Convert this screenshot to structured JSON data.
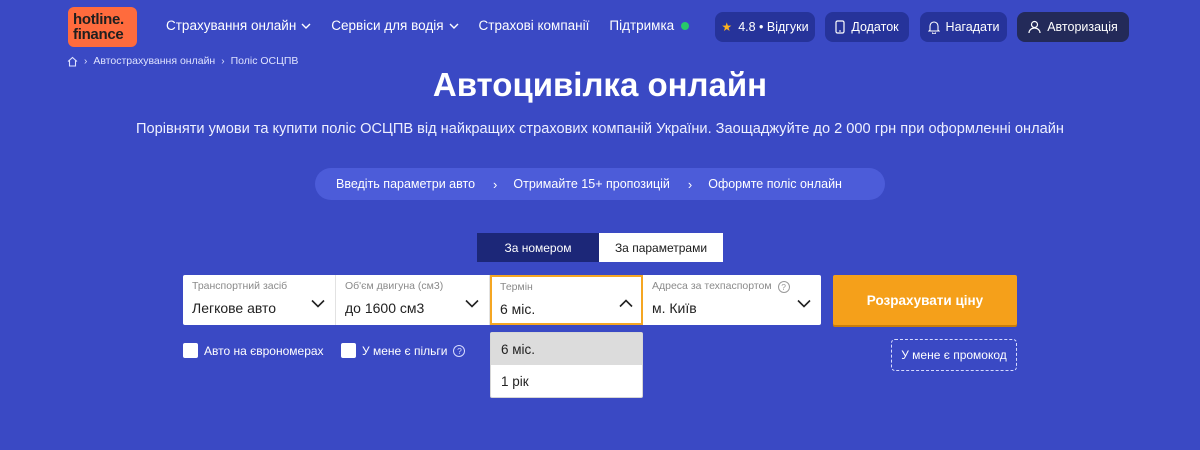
{
  "header": {
    "logo_line1": "hotline.",
    "logo_line2": "finance",
    "nav": [
      {
        "label": "Страхування онлайн",
        "has_dropdown": true
      },
      {
        "label": "Сервіси для водія",
        "has_dropdown": true
      },
      {
        "label": "Страхові компанії",
        "has_dropdown": false
      },
      {
        "label": "Підтримка",
        "status_dot": "online"
      }
    ],
    "reviews_label": "4.8 • Відгуки",
    "app_label": "Додаток",
    "notify_label": "Нагадати",
    "auth_label": "Авторизація"
  },
  "breadcrumbs": [
    "Автострахування онлайн",
    "Поліс ОСЦПВ"
  ],
  "hero": {
    "title": "Автоцивілка онлайн",
    "subtitle": "Порівняти умови та купити поліс ОСЦПВ від найкращих страхових компаній України. Заощаджуйте до 2 000 грн при оформленні онлайн",
    "steps": [
      "Введіть параметри авто",
      "Отримайте 15+ пропозицій",
      "Оформте поліс онлайн"
    ]
  },
  "tabs": [
    {
      "label": "За номером",
      "active": true
    },
    {
      "label": "За параметрами",
      "active": false
    }
  ],
  "form": {
    "vehicle": {
      "label": "Транспортний засіб",
      "value": "Легкове авто"
    },
    "engine": {
      "label": "Об'єм двигуна (см3)",
      "value": "до 1600 см3"
    },
    "term": {
      "label": "Термін",
      "value": "6 міс.",
      "open": true,
      "options": [
        "6 міс.",
        "1 рік"
      ],
      "highlighted": 0
    },
    "address": {
      "label": "Адреса за техпаспортом",
      "value": "м. Київ"
    },
    "submit_label": "Розрахувати ціну",
    "promo_label": "У мене є промокод",
    "checkbox_euro": "Авто на єврономерах",
    "checkbox_benefits": "У мене є пільги"
  },
  "colors": {
    "background": "#3a49c4",
    "accent": "#f5a01a",
    "logo": "#ff6b3d",
    "active_tab": "#1c2778"
  }
}
